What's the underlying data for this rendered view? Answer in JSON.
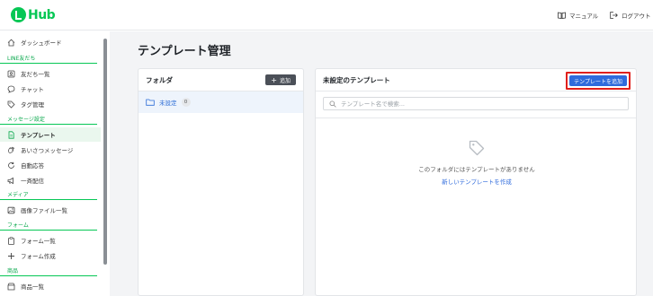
{
  "header": {
    "logo_text": "Hub",
    "manual_label": "マニュアル",
    "logout_label": "ログアウト"
  },
  "sidebar": {
    "items": [
      {
        "label": "ダッシュボード",
        "icon": "home-icon"
      },
      {
        "section": "LINE友だち"
      },
      {
        "label": "友だち一覧",
        "icon": "users-icon"
      },
      {
        "label": "チャット",
        "icon": "chat-icon"
      },
      {
        "label": "タグ管理",
        "icon": "tag-icon"
      },
      {
        "section": "メッセージ設定"
      },
      {
        "label": "テンプレート",
        "icon": "document-icon",
        "active": true
      },
      {
        "label": "あいさつメッセージ",
        "icon": "wave-icon"
      },
      {
        "label": "自動応答",
        "icon": "refresh-icon"
      },
      {
        "label": "一斉配信",
        "icon": "broadcast-icon"
      },
      {
        "section": "メディア"
      },
      {
        "label": "画像ファイル一覧",
        "icon": "image-icon"
      },
      {
        "section": "フォーム"
      },
      {
        "label": "フォーム一覧",
        "icon": "clipboard-icon"
      },
      {
        "label": "フォーム作成",
        "icon": "plus-icon"
      },
      {
        "section": "商品"
      },
      {
        "label": "商品一覧",
        "icon": "shop-icon"
      }
    ]
  },
  "main": {
    "title": "テンプレート管理",
    "folder_panel": {
      "title": "フォルダ",
      "add_label": "追加",
      "folders": [
        {
          "name": "未設定",
          "count": "0"
        }
      ]
    },
    "template_panel": {
      "title": "未設定のテンプレート",
      "add_template_label": "テンプレートを追加",
      "search_placeholder": "テンプレート名で検索...",
      "empty_text": "このフォルダにはテンプレートがありません",
      "create_link": "新しいテンプレートを作成"
    }
  },
  "colors": {
    "brand": "#06c755",
    "primary": "#2f6bdc",
    "highlight": "#e0201c"
  }
}
